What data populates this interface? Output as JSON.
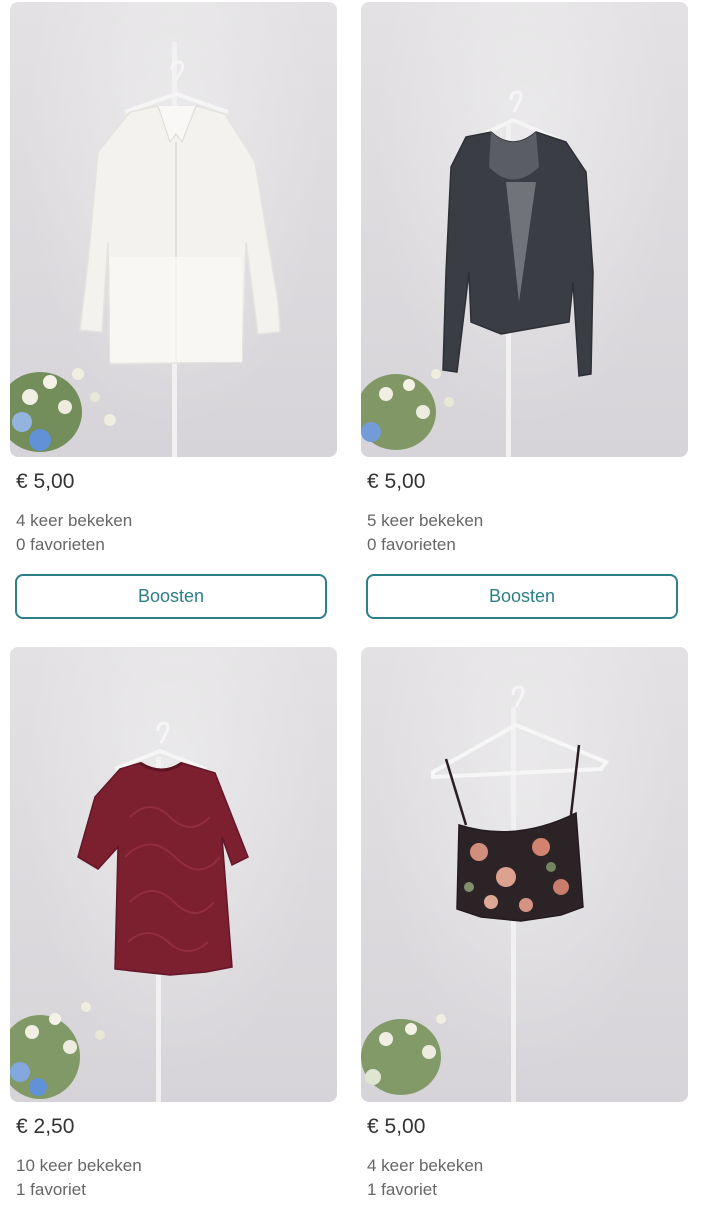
{
  "listings": [
    {
      "price": "€ 5,00",
      "views": "4 keer bekeken",
      "favorites": "0 favorieten",
      "boost_label": "Boosten",
      "garment": "white-blouse"
    },
    {
      "price": "€ 5,00",
      "views": "5 keer bekeken",
      "favorites": "0 favorieten",
      "boost_label": "Boosten",
      "garment": "dark-grey-sweater"
    },
    {
      "price": "€ 2,50",
      "views": "10 keer bekeken",
      "favorites": "1 favoriet",
      "garment": "burgundy-tshirt"
    },
    {
      "price": "€ 5,00",
      "views": "4 keer bekeken",
      "favorites": "1 favoriet",
      "garment": "floral-crop-top"
    }
  ],
  "colors": {
    "accent": "#2d7f86",
    "text_primary": "#333333",
    "text_secondary": "#666666"
  }
}
